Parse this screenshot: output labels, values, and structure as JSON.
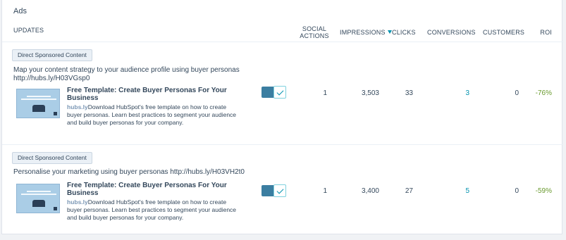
{
  "title": "Ads",
  "columns": {
    "updates": "UPDATES",
    "social_actions_1": "SOCIAL",
    "social_actions_2": "ACTIONS",
    "impressions": "IMPRESSIONS",
    "clicks": "CLICKS",
    "conversions": "CONVERSIONS",
    "customers": "CUSTOMERS",
    "roi": "ROI"
  },
  "sort": {
    "column": "impressions",
    "direction": "descending"
  },
  "rows": [
    {
      "tag": "Direct Sponsored Content",
      "text_line1": "Map your content strategy to your audience profile using buyer personas",
      "text_line2": "http://hubs.ly/H03VGsp0",
      "link_title": "Free Template: Create Buyer Personas For Your Business",
      "link_domain": "hubs.ly",
      "link_desc": "Download HubSpot's free template on how to create buyer personas. Learn best practices to segment your audience and build buyer personas for your company.",
      "enabled": true,
      "social_actions": "1",
      "impressions": "3,503",
      "clicks": "33",
      "conversions": "3",
      "customers": "0",
      "roi": "-76%"
    },
    {
      "tag": "Direct Sponsored Content",
      "text_line1": "Personalise your marketing using buyer personas http://hubs.ly/H03VH2t0",
      "text_line2": "",
      "link_title": "Free Template: Create Buyer Personas For Your Business",
      "link_domain": "hubs.ly",
      "link_desc": "Download HubSpot's free template on how to create buyer personas. Learn best practices to segment your audience and build buyer personas for your company.",
      "enabled": true,
      "social_actions": "1",
      "impressions": "3,400",
      "clicks": "27",
      "conversions": "5",
      "customers": "0",
      "roi": "-59%"
    }
  ],
  "colors": {
    "link": "#0091ae",
    "roi_negative": "#6a9a2f",
    "toggle": "#3b7ea1"
  }
}
